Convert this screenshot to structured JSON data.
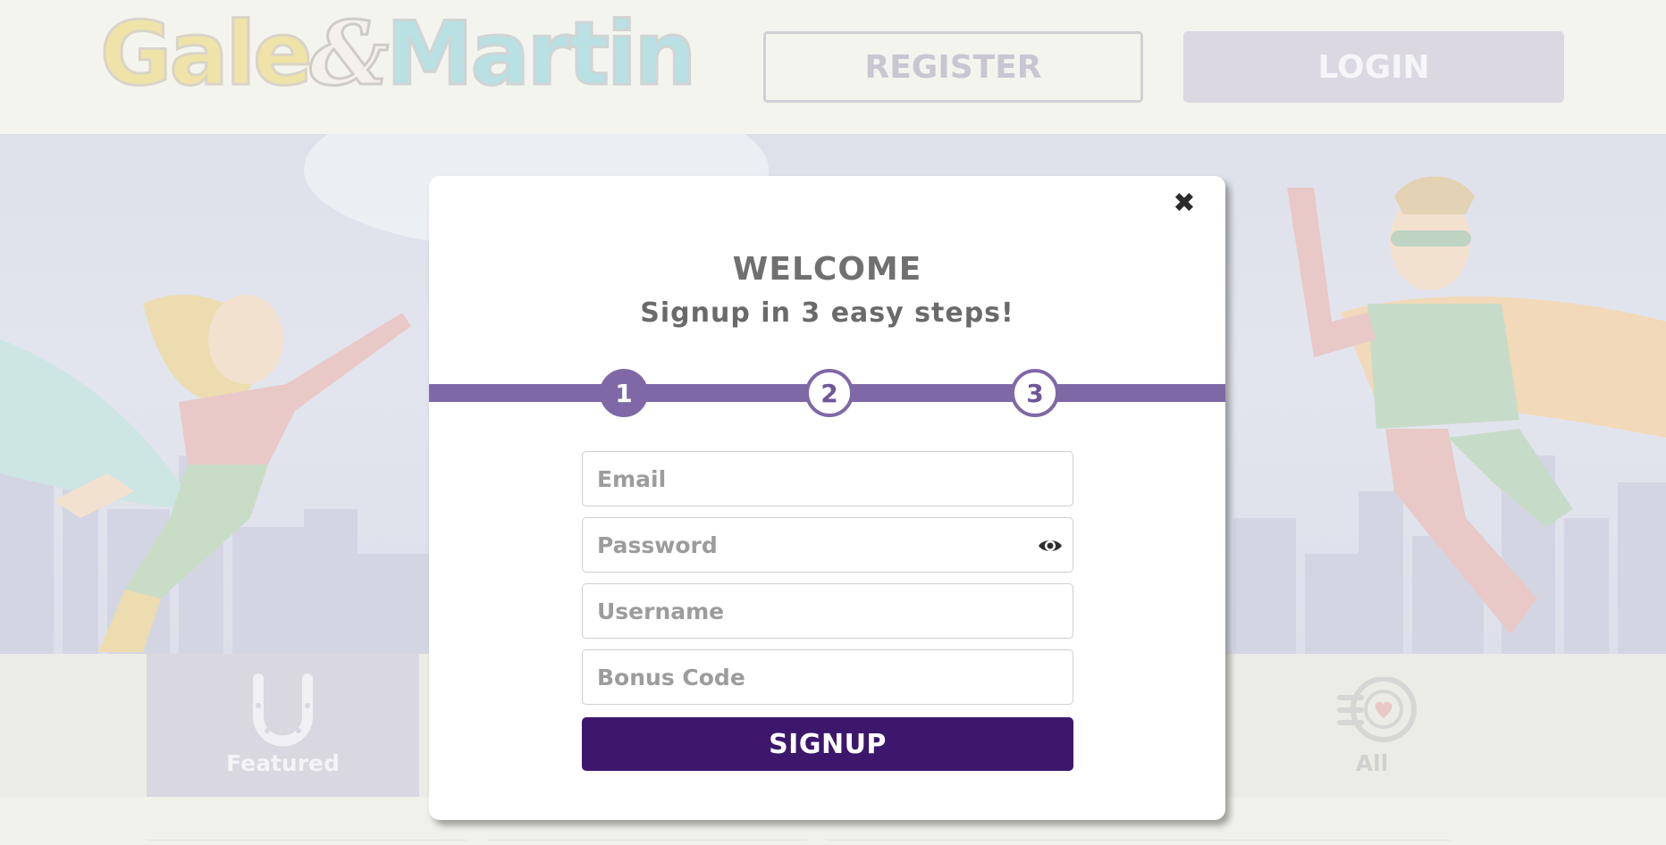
{
  "header": {
    "logo_parts": [
      "Gale",
      "&",
      "Martin"
    ],
    "register_label": "REGISTER",
    "login_label": "LOGIN"
  },
  "categories": [
    {
      "label": "Featured",
      "icon": "horseshoe-icon"
    },
    {
      "label": "All",
      "icon": "chip-stack-icon"
    }
  ],
  "modal": {
    "close_icon": "close-icon",
    "title": "WELCOME",
    "subtitle": "Signup in 3 easy steps!",
    "steps": [
      "1",
      "2",
      "3"
    ],
    "active_step": 1,
    "fields": {
      "email_placeholder": "Email",
      "password_placeholder": "Password",
      "username_placeholder": "Username",
      "bonus_code_placeholder": "Bonus Code"
    },
    "password_toggle_icon": "eye-icon",
    "signup_label": "SIGNUP"
  },
  "colors": {
    "accent_purple": "#7f68a6",
    "signup_button": "#3c176c",
    "title_gray": "#707070",
    "overlay_tint": "#f1f1ec"
  }
}
